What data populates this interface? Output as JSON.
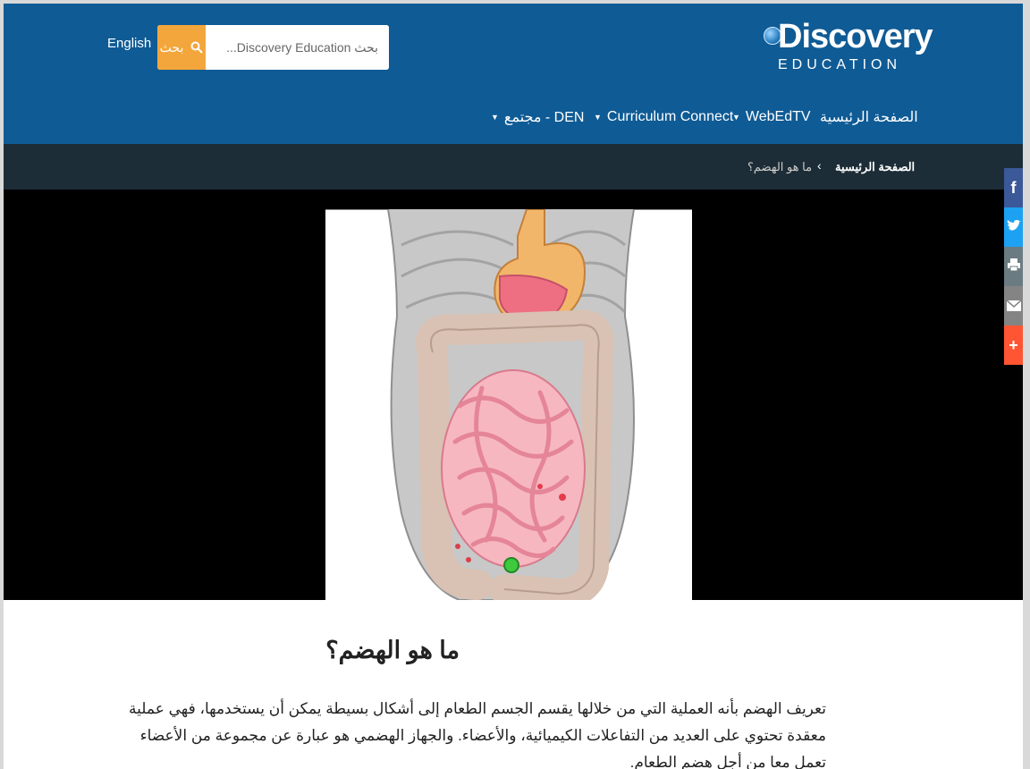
{
  "header": {
    "language_link": "English",
    "search": {
      "placeholder": "بحث Discovery Education...",
      "button_label": "بحث"
    },
    "logo": {
      "word": "Discovery",
      "sub": "EDUCATION"
    },
    "nav": [
      {
        "label": "الصفحة الرئيسية",
        "has_dropdown": false
      },
      {
        "label": "WebEdTV",
        "has_dropdown": true
      },
      {
        "label": "Curriculum Connect",
        "has_dropdown": true
      },
      {
        "label": "مجتمع - DEN",
        "has_dropdown": true
      }
    ]
  },
  "breadcrumb": {
    "home": "الصفحة الرئيسية",
    "separator": "‹",
    "current": "ما هو الهضم؟"
  },
  "social": [
    {
      "name": "facebook",
      "icon": "f",
      "color": "#3b5998"
    },
    {
      "name": "twitter",
      "icon": "t",
      "color": "#1da1f2"
    },
    {
      "name": "print",
      "icon": "print-icon",
      "color": "#6b7b82"
    },
    {
      "name": "email",
      "icon": "email-icon",
      "color": "#848484"
    },
    {
      "name": "share-more",
      "icon": "+",
      "color": "#ff5533"
    }
  ],
  "article": {
    "title": "ما هو الهضم؟",
    "paragraph": "تعريف الهضم بأنه العملية التي من خلالها يقسم الجسم الطعام إلى أشكال بسيطة يمكن أن يستخدمها، فهي عملية معقدة تحتوي على العديد من التفاعلات الكيميائية، والأعضاء. والجهاز الهضمي هو عبارة عن مجموعة من الأعضاء تعمل معا من أجل هضم الطعام."
  },
  "colors": {
    "header_bg": "#0f5b95",
    "breadcrumb_bg": "#1d2d37",
    "search_button": "#f3a63b"
  }
}
